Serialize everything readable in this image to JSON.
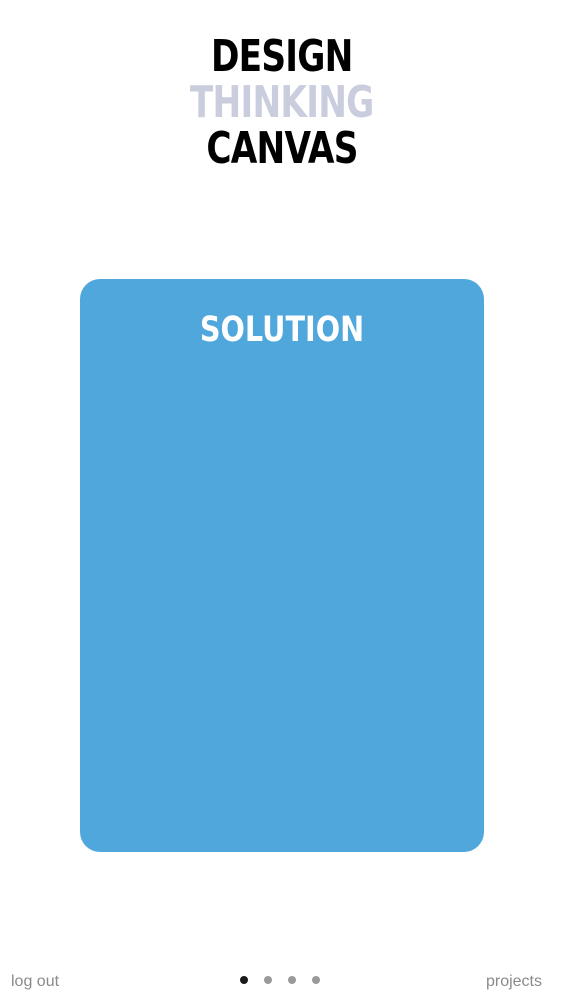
{
  "logo": {
    "line1": "DESIGN",
    "line2": "THINKING",
    "line3": "CANVAS"
  },
  "card": {
    "title": "SOLUTION",
    "color": "#4fa7dc"
  },
  "footer": {
    "left_label": "log out",
    "right_label": "projects"
  },
  "pager": {
    "total": 4,
    "active_index": 0,
    "active_color": "#1a1a1a",
    "inactive_color": "#9a9a9a"
  }
}
